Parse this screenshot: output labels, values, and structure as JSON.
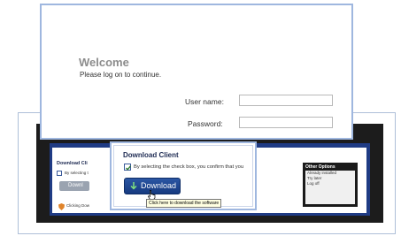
{
  "colors": {
    "frame_border": "#9fb7df",
    "welcome_text": "#8c8c8c",
    "download_button": "#1f4a96",
    "page_banner": "#1f3b84",
    "tooltip_bg": "#ffffe1"
  },
  "login": {
    "title": "Welcome",
    "prompt": "Please log on to continue.",
    "username_label": "User name:",
    "username_value": "",
    "password_label": "Password:",
    "password_value": ""
  },
  "download_dialog": {
    "title": "Download Client",
    "checkbox_label": "By selecting the check box, you confirm that you",
    "checkbox_checked": true,
    "button_icon": "download-arrow-icon",
    "button_label": "Download",
    "tooltip": "Click here to download the software"
  },
  "background_page": {
    "title": "Download Cli",
    "checkbox_label": "By selecting t",
    "button_label": "Downl",
    "footer_text": "Clicking Dow",
    "other_options": {
      "title": "Other Options",
      "items": [
        "Already installed",
        "Try later",
        "Log off"
      ]
    }
  }
}
